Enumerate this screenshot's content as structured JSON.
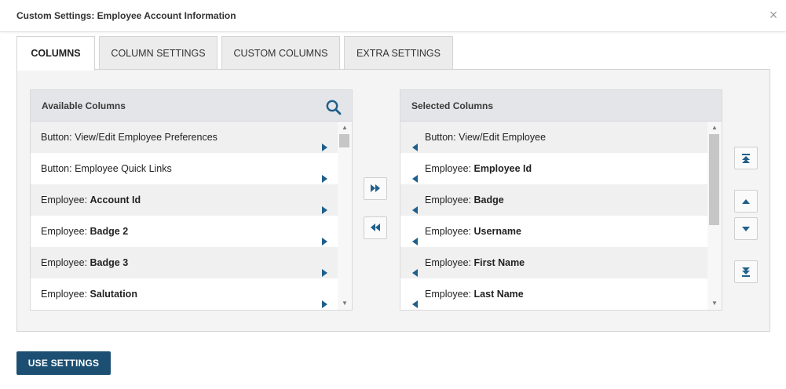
{
  "dialog": {
    "title": "Custom Settings: Employee Account Information",
    "close_glyph": "×"
  },
  "tabs": [
    {
      "label": "COLUMNS",
      "active": true
    },
    {
      "label": "COLUMN SETTINGS",
      "active": false
    },
    {
      "label": "CUSTOM COLUMNS",
      "active": false
    },
    {
      "label": "EXTRA SETTINGS",
      "active": false
    }
  ],
  "available": {
    "header": "Available Columns",
    "search_icon": "search-icon",
    "items": [
      {
        "prefix": "Button: View/Edit Employee Preferences",
        "suffix": ""
      },
      {
        "prefix": "Button: Employee Quick Links",
        "suffix": ""
      },
      {
        "prefix": "Employee: ",
        "suffix": "Account Id"
      },
      {
        "prefix": "Employee: ",
        "suffix": "Badge 2"
      },
      {
        "prefix": "Employee: ",
        "suffix": "Badge 3"
      },
      {
        "prefix": "Employee: ",
        "suffix": "Salutation"
      }
    ]
  },
  "selected": {
    "header": "Selected Columns",
    "items": [
      {
        "prefix": "Button: View/Edit Employee",
        "suffix": ""
      },
      {
        "prefix": "Employee: ",
        "suffix": "Employee Id"
      },
      {
        "prefix": "Employee: ",
        "suffix": "Badge"
      },
      {
        "prefix": "Employee: ",
        "suffix": "Username"
      },
      {
        "prefix": "Employee: ",
        "suffix": "First Name"
      },
      {
        "prefix": "Employee: ",
        "suffix": "Last Name"
      }
    ]
  },
  "scroll": {
    "available_position": 0.0,
    "available_visible_fraction": 0.08,
    "selected_position": 0.0,
    "selected_visible_fraction": 0.55
  },
  "colors": {
    "accent": "#1d4f73",
    "icon": "#1f5f8b",
    "header_bg": "#e3e5e8"
  },
  "footer": {
    "use_settings_label": "USE SETTINGS"
  }
}
